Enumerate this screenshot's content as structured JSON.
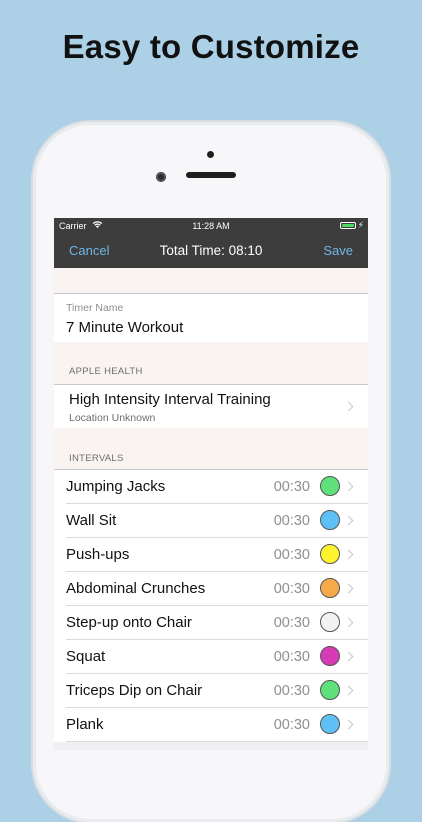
{
  "headline": "Easy to Customize",
  "status_bar": {
    "carrier": "Carrier",
    "time": "11:28 AM"
  },
  "nav": {
    "cancel": "Cancel",
    "title": "Total Time: 08:10",
    "save": "Save"
  },
  "timer_name": {
    "label": "Timer Name",
    "value": "7 Minute Workout"
  },
  "apple_health": {
    "header": "APPLE HEALTH",
    "activity": "High Intensity Interval Training",
    "location": "Location Unknown"
  },
  "intervals": {
    "header": "INTERVALS",
    "items": [
      {
        "name": "Jumping Jacks",
        "duration": "00:30",
        "color": "#5ee07a"
      },
      {
        "name": "Wall Sit",
        "duration": "00:30",
        "color": "#5ec0f5"
      },
      {
        "name": "Push-ups",
        "duration": "00:30",
        "color": "#fff22e"
      },
      {
        "name": "Abdominal Crunches",
        "duration": "00:30",
        "color": "#f6a94b"
      },
      {
        "name": "Step-up onto Chair",
        "duration": "00:30",
        "color": "#f2f2f2"
      },
      {
        "name": "Squat",
        "duration": "00:30",
        "color": "#d63bb5"
      },
      {
        "name": "Triceps Dip on Chair",
        "duration": "00:30",
        "color": "#5ee07a"
      },
      {
        "name": "Plank",
        "duration": "00:30",
        "color": "#5ec0f5"
      }
    ]
  },
  "colors": {
    "background": "#acd1e6",
    "nav_bar": "#3d3d3d",
    "nav_link": "#6fb6e6",
    "battery": "#4cd964"
  }
}
